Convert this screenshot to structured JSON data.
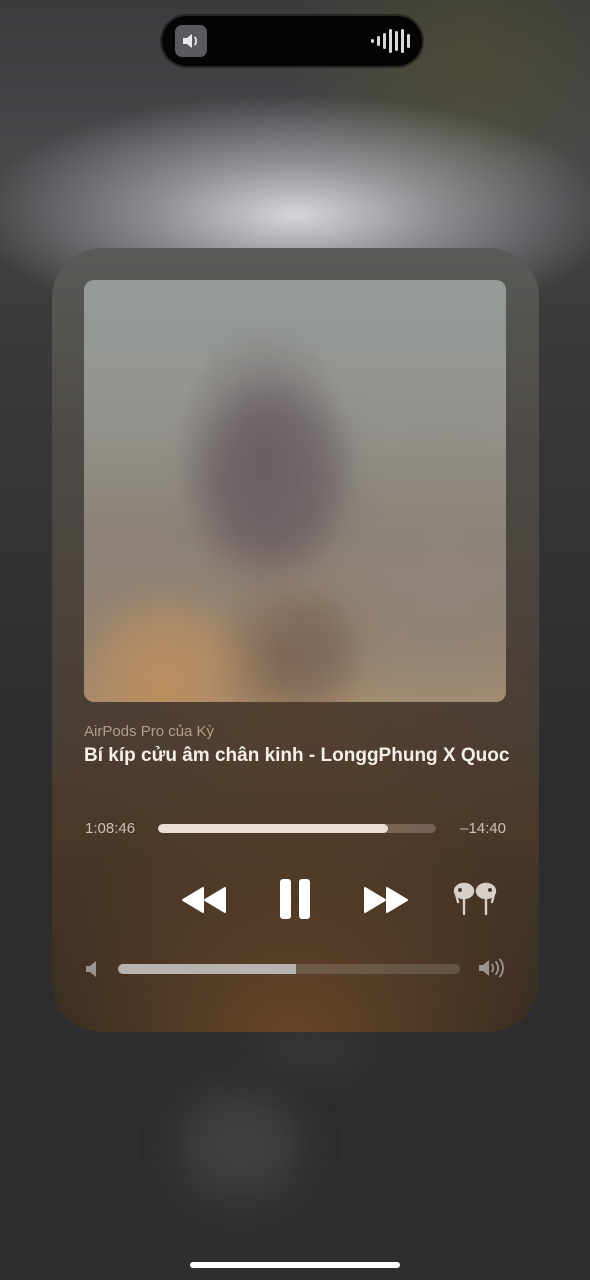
{
  "status": {
    "speaker_icon": "speaker-icon",
    "audio_wave_icon": "audio-waveform-icon"
  },
  "now_playing": {
    "device_name": "AirPods Pro của Kỳ",
    "track_title": "Bí kíp cửu âm chân kinh - LonggPhung X QuocB",
    "time_elapsed": "1:08:46",
    "time_remaining": "–14:40",
    "progress_fraction": 0.827,
    "volume_fraction": 0.52
  },
  "controls": {
    "rewind_icon": "rewind-icon",
    "pause_icon": "pause-icon",
    "forward_icon": "fast-forward-icon",
    "airpods_icon": "airpods-pro-icon",
    "volume_low_icon": "volume-low-icon",
    "volume_high_icon": "volume-high-icon"
  },
  "colors": {
    "progress_fill": "#eaded2",
    "volume_fill": "#b7b3b0",
    "title_text": "#f4efe9"
  }
}
